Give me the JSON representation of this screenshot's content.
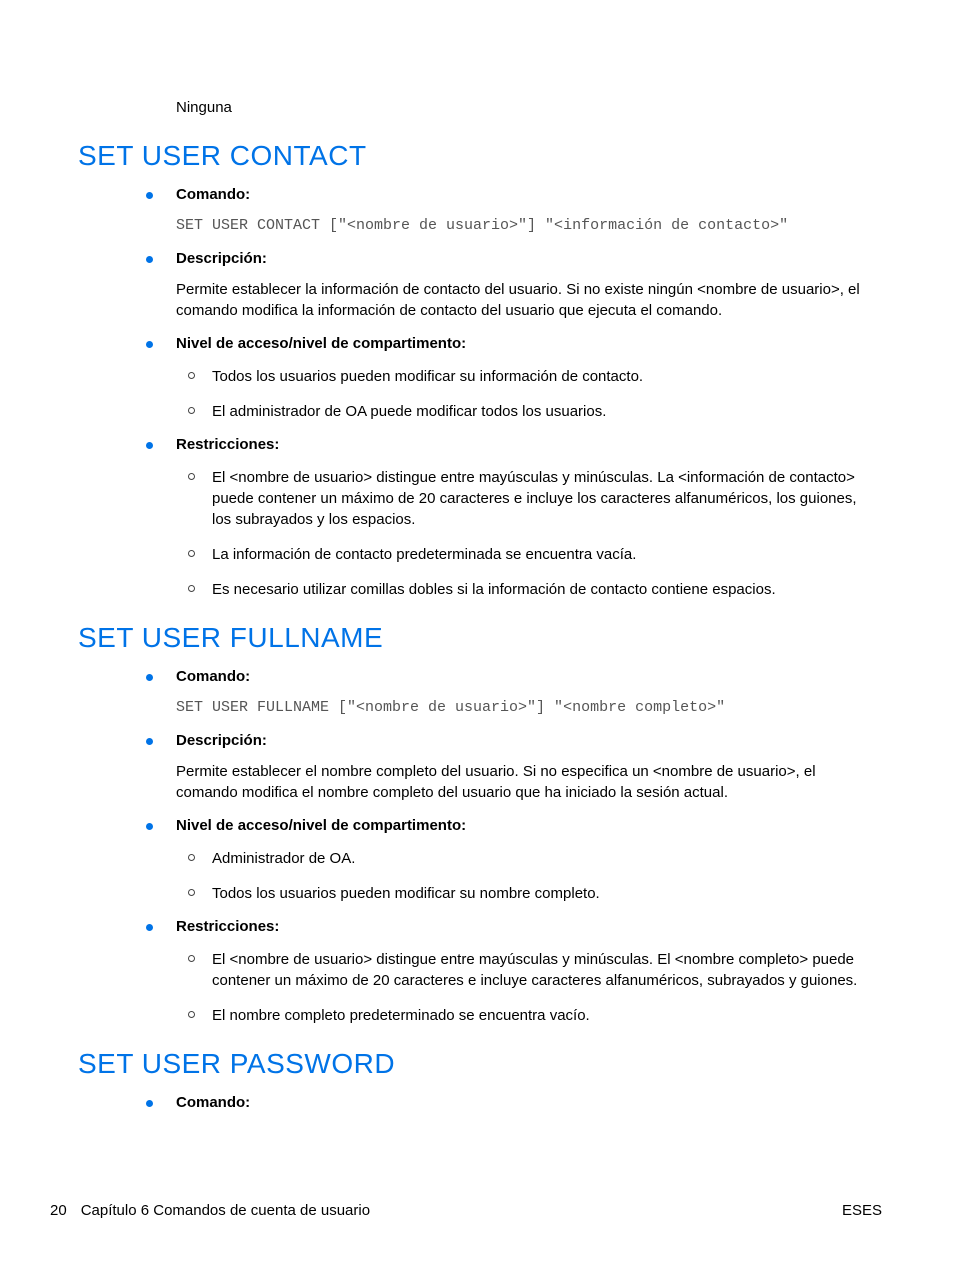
{
  "leadin": "Ninguna",
  "sections": [
    {
      "title": "SET USER CONTACT",
      "items": [
        {
          "label": "Comando:",
          "code": "SET USER CONTACT [\"<nombre de usuario>\"] \"<información de contacto>\""
        },
        {
          "label": "Descripción:",
          "body": "Permite establecer la información de contacto del usuario. Si no existe ningún <nombre de usuario>, el comando modifica la información de contacto del usuario que ejecuta el comando."
        },
        {
          "label": "Nivel de acceso/nivel de compartimento:",
          "sub": [
            "Todos los usuarios pueden modificar su información de contacto.",
            "El administrador de OA puede modificar todos los usuarios."
          ]
        },
        {
          "label": "Restricciones:",
          "sub": [
            "El <nombre de usuario> distingue entre mayúsculas y minúsculas. La <información de contacto> puede contener un máximo de 20 caracteres e incluye los caracteres alfanuméricos, los guiones, los subrayados y los espacios.",
            "La información de contacto predeterminada se encuentra vacía.",
            "Es necesario utilizar comillas dobles si la información de contacto contiene espacios."
          ]
        }
      ]
    },
    {
      "title": "SET USER FULLNAME",
      "items": [
        {
          "label": "Comando:",
          "code": "SET USER FULLNAME [\"<nombre de usuario>\"] \"<nombre completo>\""
        },
        {
          "label": "Descripción:",
          "body": "Permite establecer el nombre completo del usuario. Si no especifica un <nombre de usuario>, el comando modifica el nombre completo del usuario que ha iniciado la sesión actual."
        },
        {
          "label": "Nivel de acceso/nivel de compartimento:",
          "sub": [
            "Administrador de OA.",
            "Todos los usuarios pueden modificar su nombre completo."
          ]
        },
        {
          "label": "Restricciones:",
          "sub": [
            "El <nombre de usuario> distingue entre mayúsculas y minúsculas. El <nombre completo> puede contener un máximo de 20 caracteres e incluye caracteres alfanuméricos, subrayados y guiones.",
            "El nombre completo predeterminado se encuentra vacío."
          ]
        }
      ]
    },
    {
      "title": "SET USER PASSWORD",
      "items": [
        {
          "label": "Comando:"
        }
      ]
    }
  ],
  "footer": {
    "page": "20",
    "chapter": "Capítulo 6   Comandos de cuenta de usuario",
    "lang": "ESES"
  }
}
